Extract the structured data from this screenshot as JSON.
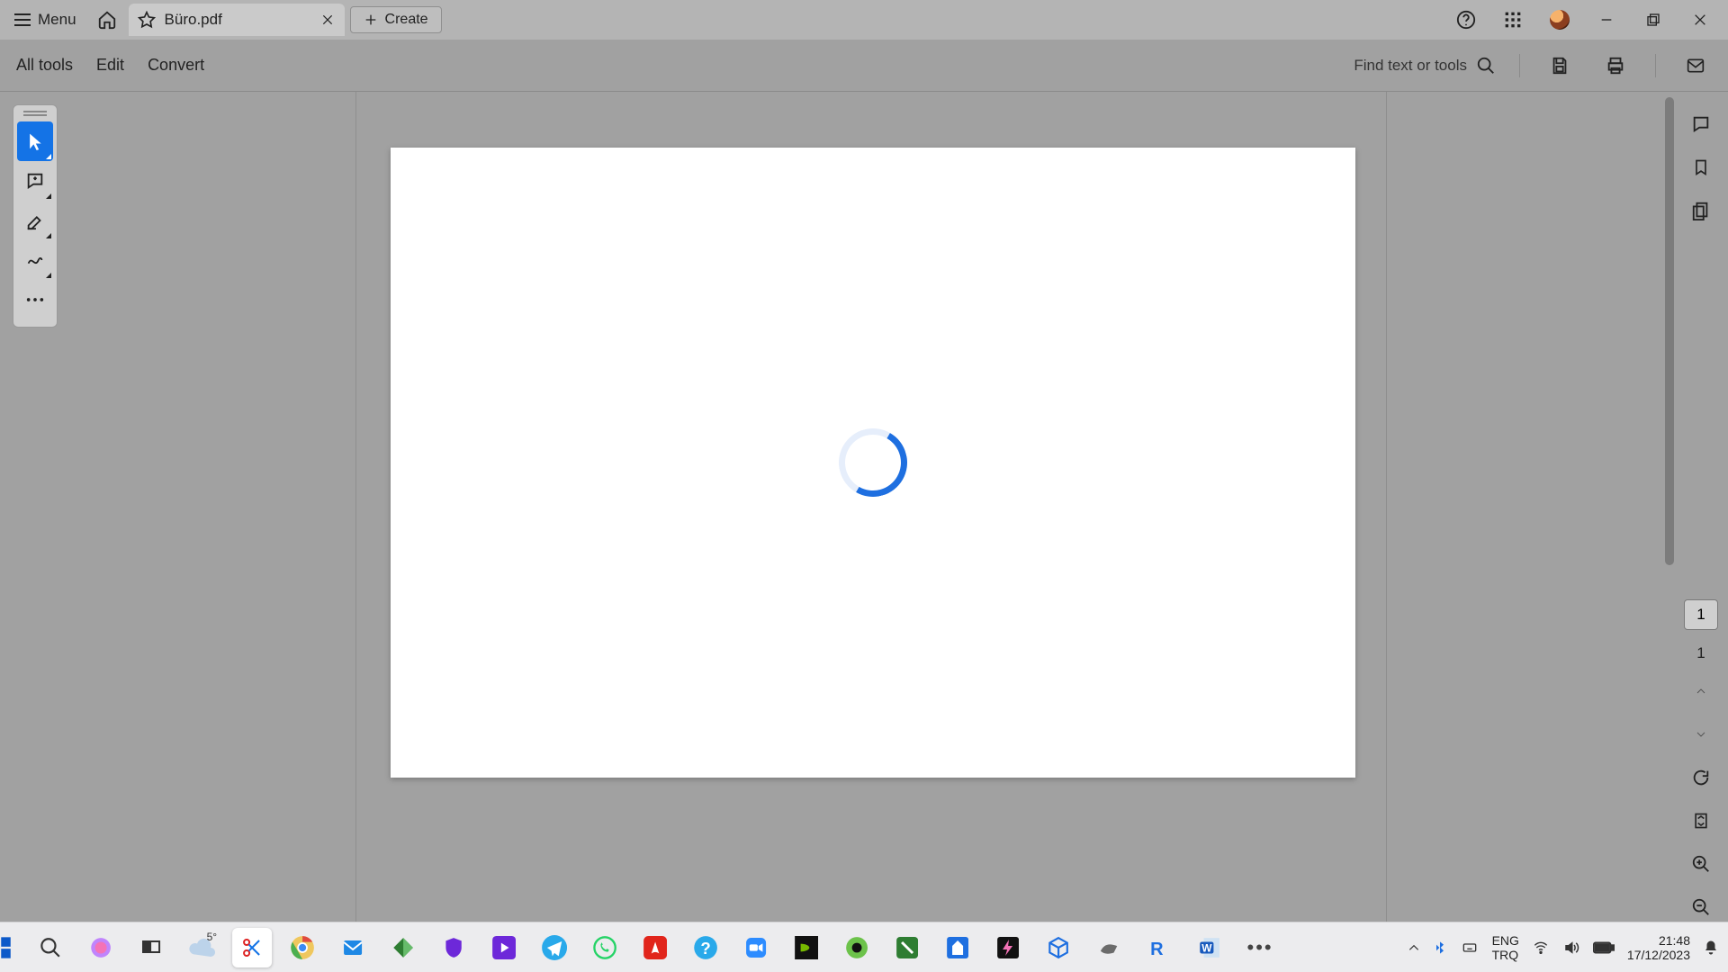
{
  "tabstrip": {
    "menu_label": "Menu",
    "tab_title": "Büro.pdf",
    "create_label": "Create"
  },
  "toolbar": {
    "all_tools": "All tools",
    "edit": "Edit",
    "convert": "Convert",
    "find_placeholder": "Find text or tools"
  },
  "pagebox": {
    "current": "1",
    "total": "1"
  },
  "systray": {
    "lang1": "ENG",
    "lang2": "TRQ",
    "time": "21:48",
    "date": "17/12/2023",
    "weather_temp": "5°"
  }
}
